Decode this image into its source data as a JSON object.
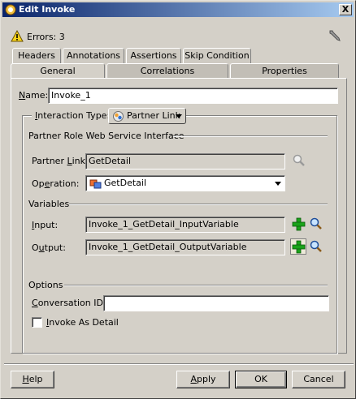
{
  "window": {
    "title": "Edit Invoke",
    "close_glyph": "X"
  },
  "status": {
    "errors_label": "Errors: 3"
  },
  "tabs": {
    "row1": [
      {
        "label": "Headers"
      },
      {
        "label": "Annotations"
      },
      {
        "label": "Assertions"
      },
      {
        "label": "Skip Condition"
      }
    ],
    "row2": [
      {
        "label": "General",
        "active": true
      },
      {
        "label": "Correlations"
      },
      {
        "label": "Properties"
      }
    ]
  },
  "general": {
    "name_label": "Name:",
    "name_value": "Invoke_1",
    "interaction_label": "Interaction Type:",
    "interaction_value": "Partner Link",
    "partner_section": "Partner Role Web Service Interface",
    "partner_link_label": "Partner Link:",
    "partner_link_value": "GetDetail",
    "operation_label": "Operation:",
    "operation_value": "GetDetail",
    "variables_section": "Variables",
    "input_label": "Input:",
    "input_value": "Invoke_1_GetDetail_InputVariable",
    "output_label": "Output:",
    "output_value": "Invoke_1_GetDetail_OutputVariable",
    "options_section": "Options",
    "conversation_label": "Conversation ID:",
    "conversation_value": "",
    "invoke_detail_label": "Invoke As Detail",
    "invoke_detail_checked": false
  },
  "buttons": {
    "help": "Help",
    "apply": "Apply",
    "ok": "OK",
    "cancel": "Cancel"
  },
  "icons": {
    "window": "app-icon",
    "warning": "warning-icon",
    "wrench": "wrench-icon",
    "partner_link": "partner-link-icon",
    "operation": "operation-icon",
    "search": "search-icon",
    "add": "add-icon"
  },
  "colors": {
    "titlebar_start": "#0a246a",
    "titlebar_end": "#a6caf0",
    "dialog_bg": "#d4d0c8",
    "add_green": "#1aa31a"
  }
}
